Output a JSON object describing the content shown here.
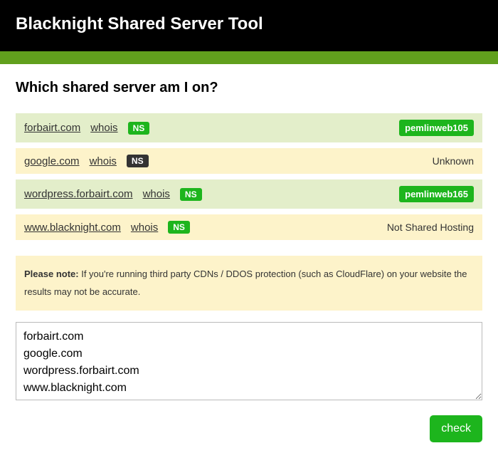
{
  "header": {
    "title": "Blacknight Shared Server Tool"
  },
  "subtitle": "Which shared server am I on?",
  "rows": [
    {
      "domain": "forbairt.com",
      "whois": "whois",
      "ns_label": "NS",
      "ns_style": "green",
      "server": "pemlinweb105",
      "server_style": "badge",
      "row_style": "green"
    },
    {
      "domain": "google.com",
      "whois": "whois",
      "ns_label": "NS",
      "ns_style": "dark",
      "server": "Unknown",
      "server_style": "text",
      "row_style": "yellow"
    },
    {
      "domain": "wordpress.forbairt.com",
      "whois": "whois",
      "ns_label": "NS",
      "ns_style": "green",
      "server": "pemlinweb165",
      "server_style": "badge",
      "row_style": "green"
    },
    {
      "domain": "www.blacknight.com",
      "whois": "whois",
      "ns_label": "NS",
      "ns_style": "green",
      "server": "Not Shared Hosting",
      "server_style": "text",
      "row_style": "yellow"
    }
  ],
  "note": {
    "label": "Please note:",
    "text": " If you're running third party CDNs / DDOS protection (such as CloudFlare) on your website the results may not be accurate."
  },
  "textarea_value": "forbairt.com\ngoogle.com\nwordpress.forbairt.com\nwww.blacknight.com",
  "check_label": "check"
}
